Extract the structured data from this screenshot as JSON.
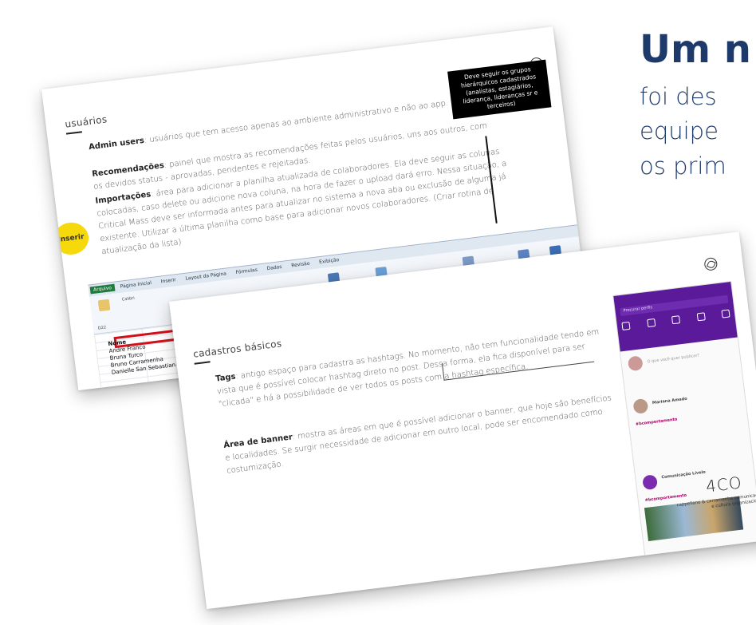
{
  "heading": "Um n",
  "subtitle_lines": [
    "foi des",
    "equipe",
    "os prim"
  ],
  "slide1": {
    "title": "usuários",
    "p1_label": "Admin users",
    "p1_text": ": usuários que tem acesso apenas ao ambiente administrativo e não ao app.",
    "p2_label": "Recomendações",
    "p2_text": ": painel que mostra as recomendações feitas pelos usuários, uns aos outros, com os devidos status - aprovadas, pendentes e rejeitadas.",
    "p3_label": "Importações",
    "p3_text": ": área para adicionar a planilha atualizada de colaboradores. Ela deve seguir as colunas colocadas, caso delete ou adicione nova coluna, na hora de fazer o upload dará erro. Nessa situação, a Critical Mass deve ser informada antes para atualizar no sistema a nova aba ou exclusão de alguma já existente. Utilizar a última planilha como base para adicionar novos colaboradores. (Criar rotina de atualização da lista)",
    "note": "Deve seguir os grupos hierárquicos cadastrados (analistas, estagiários, liderança, lideranças sr e terceiros)",
    "sticker": "Inserir",
    "excel": {
      "file_tab": "Arquivo",
      "tabs": [
        "Página Inicial",
        "Inserir",
        "Layout da Página",
        "Fórmulas",
        "Dados",
        "Revisão",
        "Exibição"
      ],
      "font": "Calibri",
      "cell": "D22",
      "column_header": "Nome",
      "rows": [
        "Andre Franco",
        "Bruna Turco",
        "Bruno Carramenha",
        "Danielle San Sebastian"
      ]
    }
  },
  "slide2": {
    "title": "cadastros básicos",
    "p1_label": "Tags",
    "p1_text": ": antigo espaço para cadastra as hashtags. No momento, não tem funcionalidade tendo em vista que é possível colocar hashtag direto no post. Dessa forma, ela fica disponível para ser \"clicada\" e há a possibilidade de ver todos os posts com a hashtag específica.",
    "p2_label": "Área de banner",
    "p2_text": ": mostra as áreas em que é possível adicionar o banner, que hoje são benefícios e localidades. Se surgir necessidade de adicionar em outro local, pode ser encomendado como costumização.",
    "phone": {
      "search": "Procurar perfis",
      "placeholder": "O que você quer publicar?",
      "user1": "Mariana Amado",
      "hashtag1": "#bcomportamento",
      "user2": "Comunicação Lívelo",
      "hashtag2": "#bcomportamento"
    },
    "brand": "4CO",
    "brand_sub": "cappellano & carramenha comunicação e cultura organizacional"
  },
  "colors": {
    "heading": "#1d3a6b",
    "sticker": "#f5d90a",
    "excel_highlight": "#d0101a",
    "phone_header": "#5a1a9a"
  }
}
